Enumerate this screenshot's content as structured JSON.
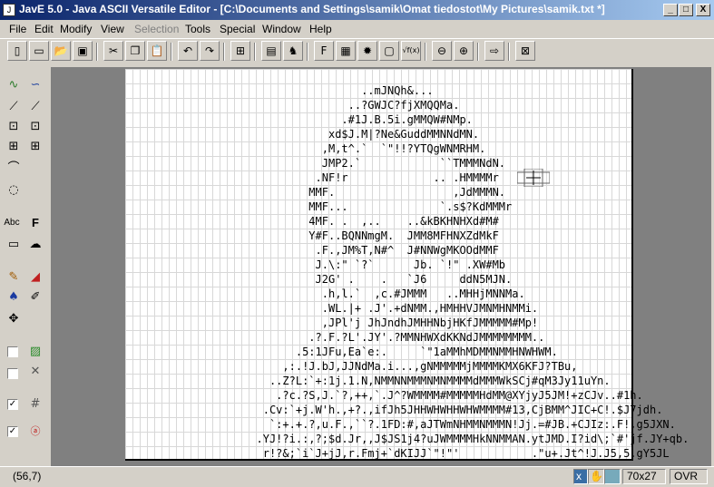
{
  "window": {
    "title": "JavE 5.0 - Java ASCII Versatile Editor - [C:\\Documents and Settings\\samik\\Omat tiedostot\\My Pictures\\samik.txt *]",
    "minimize": "_",
    "maximize": "□",
    "close": "X"
  },
  "menu": {
    "items": [
      {
        "label": "File",
        "enabled": true
      },
      {
        "label": "Edit",
        "enabled": true
      },
      {
        "label": "Modify",
        "enabled": true
      },
      {
        "label": "View",
        "enabled": true
      },
      {
        "label": "Selection",
        "enabled": false
      },
      {
        "label": "Tools",
        "enabled": true
      },
      {
        "label": "Special",
        "enabled": true
      },
      {
        "label": "Window",
        "enabled": true
      },
      {
        "label": "Help",
        "enabled": true
      }
    ]
  },
  "toolbar": {
    "icons": [
      "new-file-icon",
      "new-window-icon",
      "open-icon",
      "save-icon",
      "cut-icon",
      "copy-icon",
      "paste-icon",
      "undo-icon",
      "redo-icon",
      "select-all-icon",
      "film-icon",
      "camel-icon",
      "text-tool-icon",
      "image-icon",
      "gear-icon",
      "frame-icon",
      "formula-icon",
      "zoom-out-icon",
      "zoom-in-icon",
      "export-icon",
      "close-doc-icon"
    ],
    "glyphs": {
      "fx": "√f(x)"
    }
  },
  "left_tools": {
    "text_label": "Abc",
    "fill_label": "F"
  },
  "canvas": {
    "art": [
      "                                    ..mJNQh&...",
      "                                  ..?GWJC?fjXMQQMa.",
      "                                 .#1J.B.5i.gMMQW#NMp.",
      "                               xd$J.M|?Ne&GuddMMNNdMN.",
      "                              ,M,t^.`  `\"!!?YTQgWNMRHM.",
      "                              JMP2.`            ``TMMMNdN.",
      "                             .NF!r             .. .HMMMMr",
      "                            MMF.                  ,JdMMMN.",
      "                            MMF...              `.s$?KdMMMr",
      "                            4MF. .  ,..    ..&kBKHNHXd#M#",
      "                            Y#F..BQNNmgM.  JMM8MFHNXZdMkF",
      "                             .F.,JM%T,N#^  J#NNWgMKOOdMMF",
      "                             J.\\:\" `?`      Jb. `!\" .XW#Mb",
      "                             J2G' .    .   `J6     ddN5MJN.",
      "                              .h,l.`  ,c.#JMMM   ..MHHjMNNMa.",
      "                              .WL.|+ .J'.+dNMM.,HMHHVJMNMHNMMi.",
      "                              ,JPl'j JhJndhJMHHNbjHKfJMMMMM#Mp!",
      "                            .?.F.?L'.JY'.?MMNHWXdKKNdJMMMMMMMM..",
      "                          .5:1JFu,Ea`e:.     `\"1aMMhMDMMNMMHNWHWM.",
      "                        ,:.!J.bJ,JJNdMa.i...,gNMMMMMjMMMMKMX6KFJ?TBu,",
      "                      ..Z?L:`+:1j.1.N,NMMNNMMMNMNMMMMdMMMWkSCj#qM3Jy11uYn.",
      "                       .?c.?S,J.`?,++,`.J^?WMMMM#MMMMMHdMM@XYjyJ5JM!+zCJv..#1h.",
      "                     .Cv:`+j.W'h.,+?.,ifJh5JHHWHWHHWHWMMMM#13,CjBMM^JIC+C!.$J7jdh.",
      "                      `:+.+.?,u.F.,``?.1FD:#,aJTWmNHMMNMMMN!Jj.=#JB.+CJIz:.F!,g5JXN.",
      "                    .YJ!?i.:,?;$d.Jr,,J$JS1j4?uJWMMMMHkNNMMAN.ytJMD.I?id\\;`#'jf.JY+qb.",
      "                     r!?&;`i`J+jJ,r.Fmj+`dKIJJ`\"!\"'           .\"u+.Jt^!J.J5,5.gY5JL"
    ]
  },
  "status": {
    "position": "(56,7)",
    "mode_x": "x",
    "size": "70x27",
    "overwrite": "OVR"
  }
}
